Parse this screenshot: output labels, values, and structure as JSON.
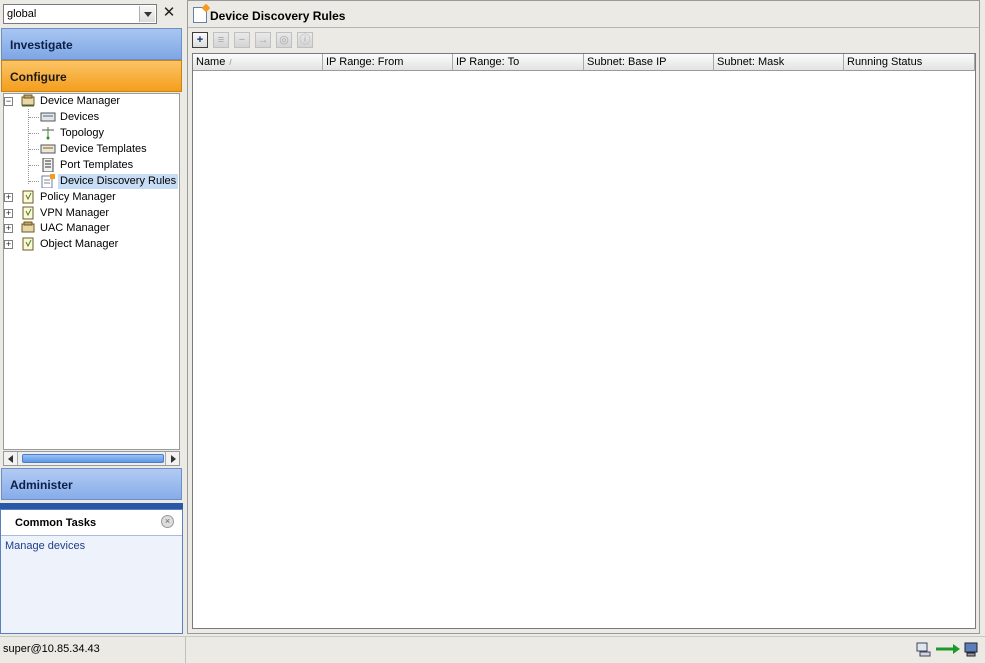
{
  "scope": {
    "value": "global",
    "close_glyph": "✕"
  },
  "accordion": {
    "investigate": "Investigate",
    "configure": "Configure",
    "administer": "Administer"
  },
  "tree": {
    "device_manager": "Device Manager",
    "children": [
      "Devices",
      "Topology",
      "Device Templates",
      "Port Templates",
      "Device Discovery Rules"
    ],
    "policy_manager": "Policy Manager",
    "vpn_manager": "VPN Manager",
    "uac_manager": "UAC Manager",
    "object_manager": "Object Manager",
    "expanded_glyph": "−",
    "collapsed_glyph": "+"
  },
  "tasks": {
    "title": "Common Tasks",
    "close_glyph": "×",
    "link": "Manage devices"
  },
  "main": {
    "title": "Device Discovery Rules",
    "toolbar": {
      "add_glyph": "+",
      "edit_glyph": "≡",
      "delete_glyph": "−",
      "run_glyph": "→",
      "stop_glyph": "◎",
      "info_glyph": "ⓘ"
    },
    "columns": [
      "Name",
      "IP Range: From",
      "IP Range: To",
      "Subnet: Base IP",
      "Subnet: Mask",
      "Running Status"
    ],
    "sort_glyph": "/"
  },
  "status": {
    "user": "super@10.85.34.43"
  },
  "colors": {
    "configure_accent": "#f49e1c",
    "investigate_accent": "#7ea6e6",
    "selected_row": "#c7dcf5"
  }
}
